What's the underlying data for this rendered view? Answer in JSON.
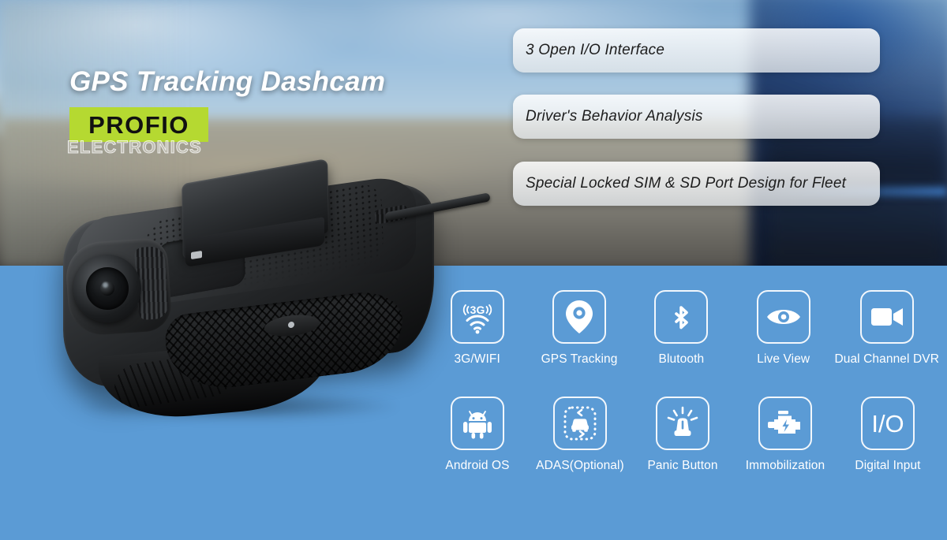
{
  "banner": {
    "headline": "GPS Tracking Dashcam",
    "logo": {
      "main": "PROFIO",
      "sub": "ELECTRONICS",
      "color": "#b5d931"
    },
    "background_color": "#5b9bd5"
  },
  "feature_pills": [
    {
      "text": "3 Open I/O Interface"
    },
    {
      "text": "Driver's Behavior Analysis"
    },
    {
      "text": "Special Locked SIM & SD Port Design for Fleet"
    }
  ],
  "product": {
    "name": "GPS tracking dashcam device",
    "color": "#1a1c1e"
  },
  "icon_rows": [
    [
      {
        "label": "3G/WIFI",
        "icon": "3g-wifi-icon"
      },
      {
        "label": "GPS Tracking",
        "icon": "map-pin-icon"
      },
      {
        "label": "Blutooth",
        "icon": "bluetooth-icon"
      },
      {
        "label": "Live View",
        "icon": "eye-icon"
      },
      {
        "label": "Dual Channel DVR",
        "icon": "video-camera-icon"
      }
    ],
    [
      {
        "label": "Android OS",
        "icon": "android-icon"
      },
      {
        "label": "ADAS(Optional)",
        "icon": "adas-car-icon"
      },
      {
        "label": "Panic Button",
        "icon": "siren-icon"
      },
      {
        "label": "Immobilization",
        "icon": "engine-bolt-icon"
      },
      {
        "label": "Digital Input",
        "icon": "io-text-icon"
      }
    ]
  ]
}
